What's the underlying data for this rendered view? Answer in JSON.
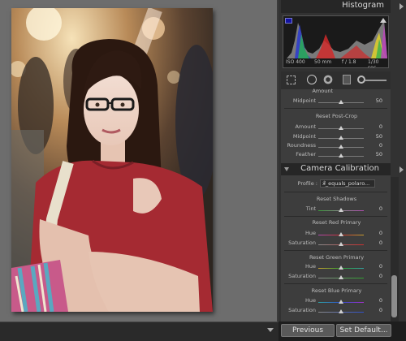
{
  "panel": {
    "histogram": {
      "title": "Histogram",
      "iso": "ISO 400",
      "focal_length": "50 mm",
      "aperture": "f / 1.8",
      "shutter": "1/30 sec"
    },
    "top_cut_label": "Amount",
    "midpoint_row": {
      "label": "Midpoint",
      "value": "50",
      "level": 0.5
    },
    "vignette": {
      "title": "Reset Post-Crop",
      "rows": [
        {
          "label": "Amount",
          "value": "0",
          "level": 0.5
        },
        {
          "label": "Midpoint",
          "value": "50",
          "level": 0.5
        },
        {
          "label": "Roundness",
          "value": "0",
          "level": 0.5
        },
        {
          "label": "Feather",
          "value": "50",
          "level": 0.5
        }
      ]
    },
    "camera_calibration": {
      "title": "Camera Calibration",
      "profile_label": "Profile :",
      "profile_value": "x_equals_polaro...",
      "profile_arrows": "⇕",
      "shadows": {
        "title": "Reset Shadows",
        "rows": [
          {
            "label": "Tint",
            "value": "0",
            "level": 0.5
          }
        ]
      },
      "red": {
        "title": "Reset Red Primary",
        "rows": [
          {
            "label": "Hue",
            "value": "0",
            "level": 0.5
          },
          {
            "label": "Saturation",
            "value": "0",
            "level": 0.5
          }
        ]
      },
      "green": {
        "title": "Reset Green Primary",
        "rows": [
          {
            "label": "Hue",
            "value": "0",
            "level": 0.5
          },
          {
            "label": "Saturation",
            "value": "0",
            "level": 0.5
          }
        ]
      },
      "blue": {
        "title": "Reset Blue Primary",
        "rows": [
          {
            "label": "Hue",
            "value": "0",
            "level": 0.5
          },
          {
            "label": "Saturation",
            "value": "0",
            "level": 0.5
          }
        ]
      }
    }
  },
  "buttons": {
    "previous": "Previous",
    "set_default": "Set Default..."
  },
  "icons": {
    "crop": "crop-overlay-icon",
    "spot": "spot-removal-icon",
    "redeye": "red-eye-icon",
    "grad": "graduated-filter-icon",
    "brush": "adjustment-brush-icon"
  },
  "colors": {
    "panel_bg": "#3d3d3d",
    "header_bg": "#262626",
    "canvas_bg": "#6d6d6d",
    "shirt": "#a52a32",
    "track_default": "#7a7a7a"
  }
}
